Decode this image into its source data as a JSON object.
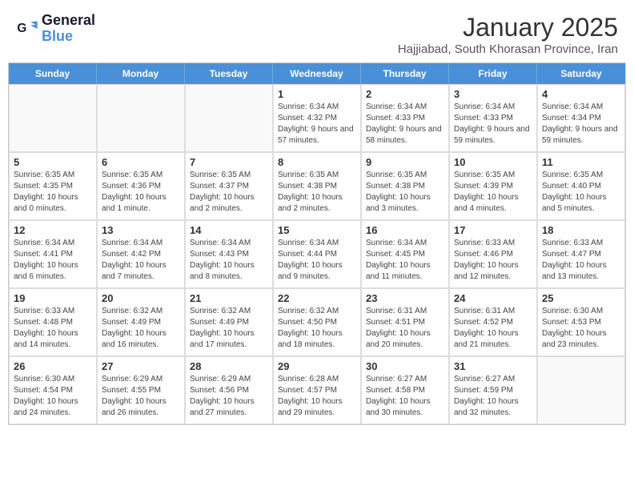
{
  "header": {
    "logo_line1": "General",
    "logo_line2": "Blue",
    "title": "January 2025",
    "subtitle": "Hajjiabad, South Khorasan Province, Iran"
  },
  "weekdays": [
    "Sunday",
    "Monday",
    "Tuesday",
    "Wednesday",
    "Thursday",
    "Friday",
    "Saturday"
  ],
  "weeks": [
    [
      {
        "day": "",
        "info": ""
      },
      {
        "day": "",
        "info": ""
      },
      {
        "day": "",
        "info": ""
      },
      {
        "day": "1",
        "info": "Sunrise: 6:34 AM\nSunset: 4:32 PM\nDaylight: 9 hours and 57 minutes."
      },
      {
        "day": "2",
        "info": "Sunrise: 6:34 AM\nSunset: 4:33 PM\nDaylight: 9 hours and 58 minutes."
      },
      {
        "day": "3",
        "info": "Sunrise: 6:34 AM\nSunset: 4:33 PM\nDaylight: 9 hours and 59 minutes."
      },
      {
        "day": "4",
        "info": "Sunrise: 6:34 AM\nSunset: 4:34 PM\nDaylight: 9 hours and 59 minutes."
      }
    ],
    [
      {
        "day": "5",
        "info": "Sunrise: 6:35 AM\nSunset: 4:35 PM\nDaylight: 10 hours and 0 minutes."
      },
      {
        "day": "6",
        "info": "Sunrise: 6:35 AM\nSunset: 4:36 PM\nDaylight: 10 hours and 1 minute."
      },
      {
        "day": "7",
        "info": "Sunrise: 6:35 AM\nSunset: 4:37 PM\nDaylight: 10 hours and 2 minutes."
      },
      {
        "day": "8",
        "info": "Sunrise: 6:35 AM\nSunset: 4:38 PM\nDaylight: 10 hours and 2 minutes."
      },
      {
        "day": "9",
        "info": "Sunrise: 6:35 AM\nSunset: 4:38 PM\nDaylight: 10 hours and 3 minutes."
      },
      {
        "day": "10",
        "info": "Sunrise: 6:35 AM\nSunset: 4:39 PM\nDaylight: 10 hours and 4 minutes."
      },
      {
        "day": "11",
        "info": "Sunrise: 6:35 AM\nSunset: 4:40 PM\nDaylight: 10 hours and 5 minutes."
      }
    ],
    [
      {
        "day": "12",
        "info": "Sunrise: 6:34 AM\nSunset: 4:41 PM\nDaylight: 10 hours and 6 minutes."
      },
      {
        "day": "13",
        "info": "Sunrise: 6:34 AM\nSunset: 4:42 PM\nDaylight: 10 hours and 7 minutes."
      },
      {
        "day": "14",
        "info": "Sunrise: 6:34 AM\nSunset: 4:43 PM\nDaylight: 10 hours and 8 minutes."
      },
      {
        "day": "15",
        "info": "Sunrise: 6:34 AM\nSunset: 4:44 PM\nDaylight: 10 hours and 9 minutes."
      },
      {
        "day": "16",
        "info": "Sunrise: 6:34 AM\nSunset: 4:45 PM\nDaylight: 10 hours and 11 minutes."
      },
      {
        "day": "17",
        "info": "Sunrise: 6:33 AM\nSunset: 4:46 PM\nDaylight: 10 hours and 12 minutes."
      },
      {
        "day": "18",
        "info": "Sunrise: 6:33 AM\nSunset: 4:47 PM\nDaylight: 10 hours and 13 minutes."
      }
    ],
    [
      {
        "day": "19",
        "info": "Sunrise: 6:33 AM\nSunset: 4:48 PM\nDaylight: 10 hours and 14 minutes."
      },
      {
        "day": "20",
        "info": "Sunrise: 6:32 AM\nSunset: 4:49 PM\nDaylight: 10 hours and 16 minutes."
      },
      {
        "day": "21",
        "info": "Sunrise: 6:32 AM\nSunset: 4:49 PM\nDaylight: 10 hours and 17 minutes."
      },
      {
        "day": "22",
        "info": "Sunrise: 6:32 AM\nSunset: 4:50 PM\nDaylight: 10 hours and 18 minutes."
      },
      {
        "day": "23",
        "info": "Sunrise: 6:31 AM\nSunset: 4:51 PM\nDaylight: 10 hours and 20 minutes."
      },
      {
        "day": "24",
        "info": "Sunrise: 6:31 AM\nSunset: 4:52 PM\nDaylight: 10 hours and 21 minutes."
      },
      {
        "day": "25",
        "info": "Sunrise: 6:30 AM\nSunset: 4:53 PM\nDaylight: 10 hours and 23 minutes."
      }
    ],
    [
      {
        "day": "26",
        "info": "Sunrise: 6:30 AM\nSunset: 4:54 PM\nDaylight: 10 hours and 24 minutes."
      },
      {
        "day": "27",
        "info": "Sunrise: 6:29 AM\nSunset: 4:55 PM\nDaylight: 10 hours and 26 minutes."
      },
      {
        "day": "28",
        "info": "Sunrise: 6:29 AM\nSunset: 4:56 PM\nDaylight: 10 hours and 27 minutes."
      },
      {
        "day": "29",
        "info": "Sunrise: 6:28 AM\nSunset: 4:57 PM\nDaylight: 10 hours and 29 minutes."
      },
      {
        "day": "30",
        "info": "Sunrise: 6:27 AM\nSunset: 4:58 PM\nDaylight: 10 hours and 30 minutes."
      },
      {
        "day": "31",
        "info": "Sunrise: 6:27 AM\nSunset: 4:59 PM\nDaylight: 10 hours and 32 minutes."
      },
      {
        "day": "",
        "info": ""
      }
    ]
  ]
}
